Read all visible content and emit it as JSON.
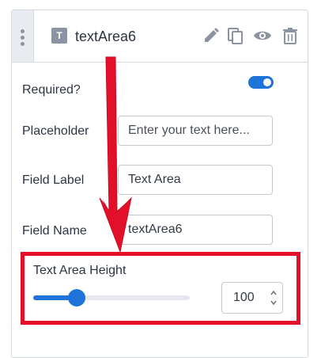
{
  "field": {
    "title": "textArea6",
    "type_icon": "text-type-icon",
    "actions": [
      "pencil-icon",
      "copy-icon",
      "eye-icon",
      "trash-icon"
    ]
  },
  "settings": {
    "required_label": "Required?",
    "required_on": true,
    "placeholder_label": "Placeholder",
    "placeholder_value": "Enter your text here...",
    "field_label_label": "Field Label",
    "field_label_value": "Text Area",
    "field_name_label": "Field Name",
    "field_name_value": "textArea6"
  },
  "height": {
    "label": "Text Area Height",
    "value": "100",
    "slider_fraction": 0.28
  },
  "colors": {
    "accent": "#1e73d8",
    "annotation": "#e3102a"
  }
}
